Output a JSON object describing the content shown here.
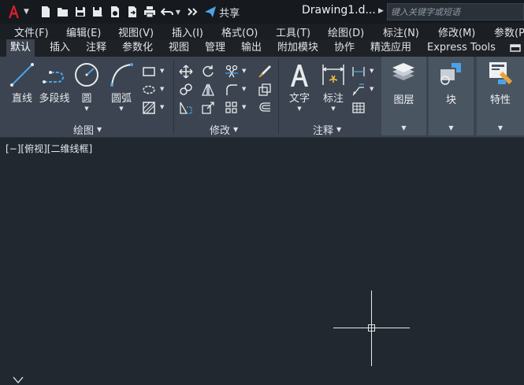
{
  "titlebar": {
    "app_logo": "autocad-a-icon",
    "share_label": "共享",
    "doc_title": "Drawing1.d...",
    "search_placeholder": "键入关键字或短语"
  },
  "menus": [
    "文件(F)",
    "编辑(E)",
    "视图(V)",
    "插入(I)",
    "格式(O)",
    "工具(T)",
    "绘图(D)",
    "标注(N)",
    "修改(M)",
    "参数(P"
  ],
  "tabs": [
    "默认",
    "插入",
    "注释",
    "参数化",
    "视图",
    "管理",
    "输出",
    "附加模块",
    "协作",
    "精选应用",
    "Express Tools"
  ],
  "active_tab": "默认",
  "ribbon": {
    "draw": {
      "title": "绘图",
      "line": "直线",
      "polyline": "多段线",
      "circle": "圆",
      "arc": "圆弧"
    },
    "modify": {
      "title": "修改"
    },
    "annotation": {
      "title": "注释",
      "text": "文字",
      "dimension": "标注"
    },
    "layers": "图层",
    "block": "块",
    "properties": "特性"
  },
  "viewport": {
    "label": "[−][俯视][二维线框]"
  },
  "colors": {
    "accent_red": "#d4212c",
    "highlight_blue": "#4aa3e8",
    "bg": "#212830",
    "ribbon": "#3b4450"
  }
}
